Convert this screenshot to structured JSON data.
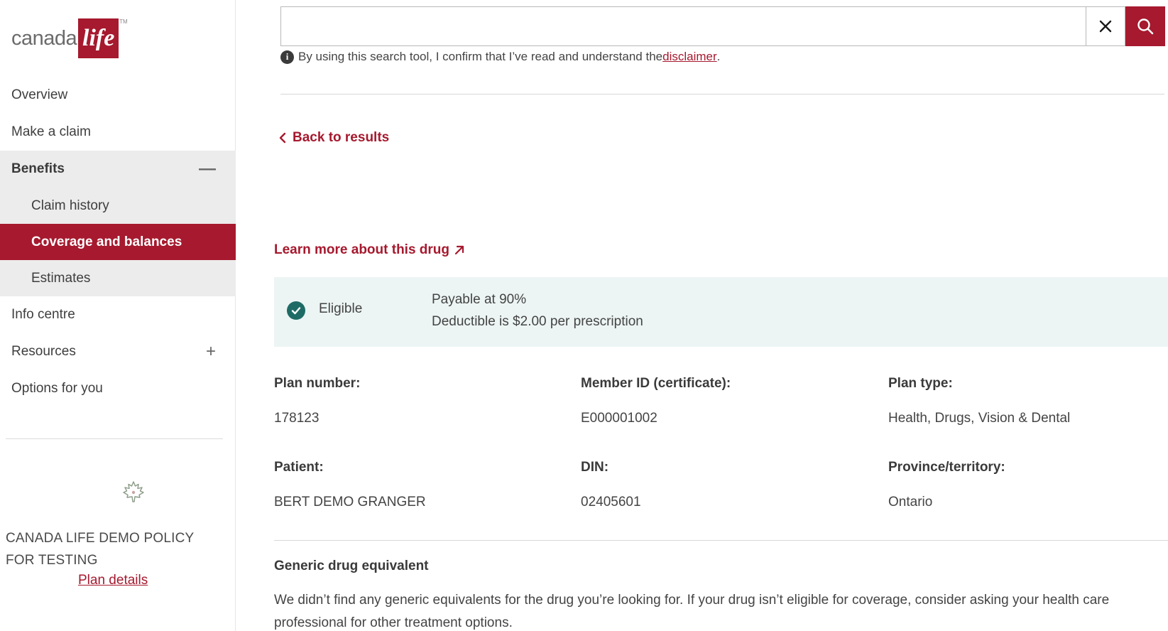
{
  "brand": {
    "logo_word": "canada",
    "logo_mark": "life",
    "logo_tm": "TM",
    "accent_color": "#a6192e"
  },
  "sidebar": {
    "items": [
      {
        "label": "Overview"
      },
      {
        "label": "Make a claim"
      },
      {
        "label": "Benefits",
        "toggle": "—"
      },
      {
        "label": "Claim history"
      },
      {
        "label": "Coverage and balances"
      },
      {
        "label": "Estimates"
      },
      {
        "label": "Info centre"
      },
      {
        "label": "Resources",
        "toggle": "+"
      },
      {
        "label": "Options for you"
      }
    ],
    "policy_name": "CANADA LIFE DEMO POLICY FOR TESTING",
    "plan_details_label": "Plan details"
  },
  "search": {
    "value": "",
    "disclaimer_text": "By using this search tool, I confirm that I’ve read and understand the ",
    "disclaimer_link": "disclaimer",
    "disclaimer_suffix": "."
  },
  "main": {
    "back_label": "Back to results",
    "learn_more_label": "Learn more about this drug",
    "status": {
      "label": "Eligible",
      "payable": "Payable at 90%",
      "deductible": "Deductible is $2.00 per prescription",
      "panel_color": "#ecf5f4",
      "check_color": "#1e6b66"
    },
    "details": {
      "plan_number_label": "Plan number:",
      "plan_number": "178123",
      "member_id_label": "Member ID (certificate):",
      "member_id": "E000001002",
      "plan_type_label": "Plan type:",
      "plan_type": "Health, Drugs, Vision & Dental",
      "patient_label": "Patient:",
      "patient": "BERT DEMO GRANGER",
      "din_label": "DIN:",
      "din": "02405601",
      "province_label": "Province/territory:",
      "province": "Ontario"
    },
    "generic": {
      "title": "Generic drug equivalent",
      "text": "We didn’t find any generic equivalents for the drug you’re looking for. If your drug isn’t eligible for coverage, consider asking your health care professional for other treatment options."
    }
  }
}
